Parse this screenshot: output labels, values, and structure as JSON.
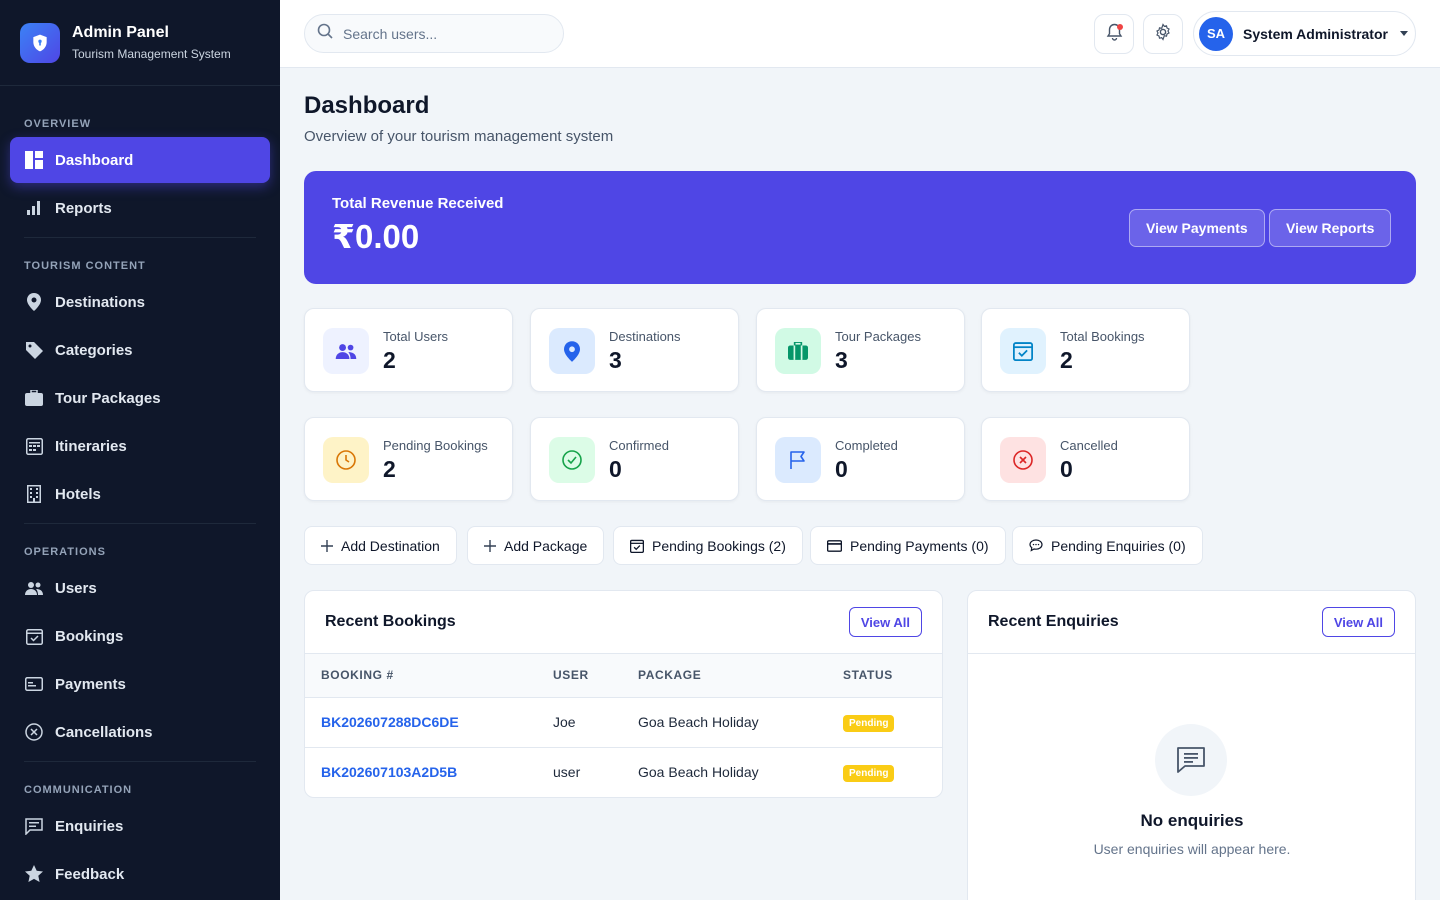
{
  "brand": {
    "title": "Admin Panel",
    "subtitle": "Tourism Management System"
  },
  "sidebar": {
    "sections": [
      {
        "heading": "OVERVIEW",
        "items": [
          {
            "label": "Dashboard",
            "icon": "dashboard-icon",
            "active": true
          },
          {
            "label": "Reports",
            "icon": "bar-chart-icon"
          }
        ]
      },
      {
        "heading": "TOURISM CONTENT",
        "items": [
          {
            "label": "Destinations",
            "icon": "map-pin-icon"
          },
          {
            "label": "Categories",
            "icon": "tag-icon"
          },
          {
            "label": "Tour Packages",
            "icon": "suitcase-icon"
          },
          {
            "label": "Itineraries",
            "icon": "calendar-grid-icon"
          },
          {
            "label": "Hotels",
            "icon": "building-icon"
          }
        ]
      },
      {
        "heading": "OPERATIONS",
        "items": [
          {
            "label": "Users",
            "icon": "users-icon"
          },
          {
            "label": "Bookings",
            "icon": "calendar-check-icon"
          },
          {
            "label": "Payments",
            "icon": "credit-card-icon"
          },
          {
            "label": "Cancellations",
            "icon": "x-circle-icon"
          }
        ]
      },
      {
        "heading": "COMMUNICATION",
        "items": [
          {
            "label": "Enquiries",
            "icon": "message-icon"
          },
          {
            "label": "Feedback",
            "icon": "star-icon"
          }
        ]
      }
    ]
  },
  "topbar": {
    "search_placeholder": "Search users...",
    "user_initials": "SA",
    "user_name": "System Administrator"
  },
  "page": {
    "title": "Dashboard",
    "subtitle": "Overview of your tourism management system"
  },
  "revenue": {
    "label": "Total Revenue Received",
    "value": "₹0.00",
    "view_payments": "View Payments",
    "view_reports": "View Reports",
    "color": "#4f46e5"
  },
  "stats": [
    {
      "label": "Total Users",
      "value": "2",
      "icon": "users-icon",
      "bg": "#eef2ff",
      "fg": "#4f46e5"
    },
    {
      "label": "Destinations",
      "value": "3",
      "icon": "map-pin-icon",
      "bg": "#dbeafe",
      "fg": "#2563eb"
    },
    {
      "label": "Tour Packages",
      "value": "3",
      "icon": "suitcase-icon",
      "bg": "#d1fae5",
      "fg": "#059669"
    },
    {
      "label": "Total Bookings",
      "value": "2",
      "icon": "calendar-check-icon",
      "bg": "#e0f2fe",
      "fg": "#0284c7"
    },
    {
      "label": "Pending Bookings",
      "value": "2",
      "icon": "clock-icon",
      "bg": "#fef3c7",
      "fg": "#d97706"
    },
    {
      "label": "Confirmed",
      "value": "0",
      "icon": "check-circle-icon",
      "bg": "#dcfce7",
      "fg": "#16a34a"
    },
    {
      "label": "Completed",
      "value": "0",
      "icon": "flag-icon",
      "bg": "#dbeafe",
      "fg": "#2563eb"
    },
    {
      "label": "Cancelled",
      "value": "0",
      "icon": "x-circle-icon",
      "bg": "#fee2e2",
      "fg": "#dc2626"
    }
  ],
  "quick_actions": [
    {
      "label": "Add Destination",
      "icon": "plus-icon"
    },
    {
      "label": "Add Package",
      "icon": "plus-icon"
    },
    {
      "label": "Pending Bookings (2)",
      "icon": "calendar-check-icon"
    },
    {
      "label": "Pending Payments (0)",
      "icon": "credit-card-icon"
    },
    {
      "label": "Pending Enquiries (0)",
      "icon": "chat-icon"
    }
  ],
  "recent_bookings": {
    "title": "Recent Bookings",
    "view_all": "View All",
    "columns": [
      "BOOKING #",
      "USER",
      "PACKAGE",
      "STATUS"
    ],
    "rows": [
      {
        "booking": "BK202607288DC6DE",
        "user": "Joe",
        "package": "Goa Beach Holiday",
        "status": "Pending"
      },
      {
        "booking": "BK202607103A2D5B",
        "user": "user",
        "package": "Goa Beach Holiday",
        "status": "Pending"
      }
    ]
  },
  "recent_enquiries": {
    "title": "Recent Enquiries",
    "view_all": "View All",
    "empty_title": "No enquiries",
    "empty_subtitle": "User enquiries will appear here."
  }
}
